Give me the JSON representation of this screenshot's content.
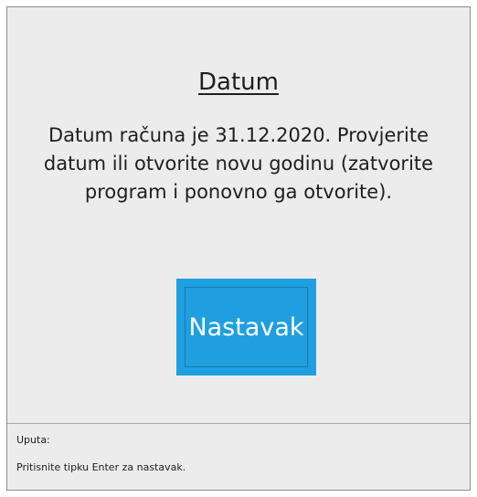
{
  "dialog": {
    "title": "Datum",
    "message": "Datum računa je 31.12.2020. Provjerite datum ili otvorite novu godinu (zatvorite program i ponovno ga otvorite).",
    "continue_button_label": "Nastavak"
  },
  "footer": {
    "label": "Uputa:",
    "text": "Pritisnite tipku Enter za nastavak."
  },
  "colors": {
    "background": "#ececec",
    "button": "#1f9fe0",
    "button_text": "#ffffff"
  }
}
